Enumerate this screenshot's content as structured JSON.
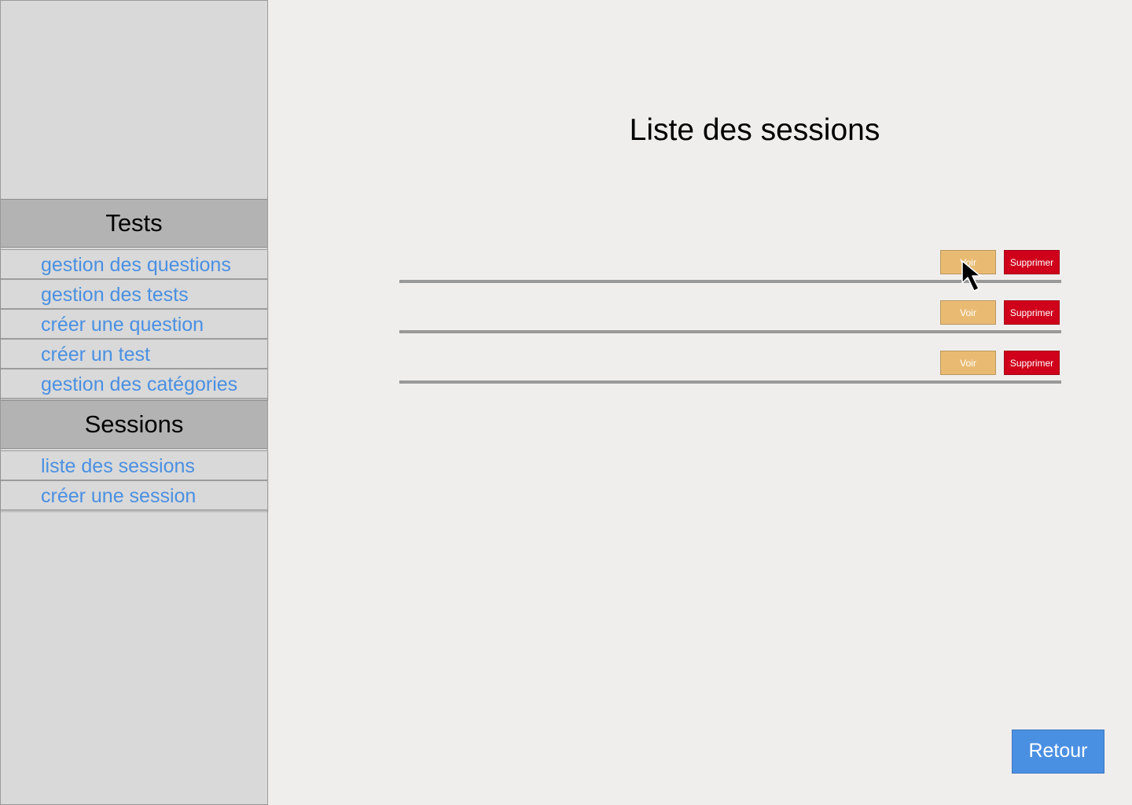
{
  "sidebar": {
    "tests_header": "Tests",
    "tests_items": [
      {
        "label": "gestion des questions"
      },
      {
        "label": "gestion des tests"
      },
      {
        "label": "créer une question"
      },
      {
        "label": "créer un test"
      },
      {
        "label": "gestion des catégories"
      }
    ],
    "sessions_header": "Sessions",
    "sessions_items": [
      {
        "label": "liste des sessions"
      },
      {
        "label": "créer une session"
      }
    ]
  },
  "main": {
    "title": "Liste des sessions",
    "rows": [
      {
        "view_label": "Voir",
        "delete_label": "Supprimer"
      },
      {
        "view_label": "Voir",
        "delete_label": "Supprimer"
      },
      {
        "view_label": "Voir",
        "delete_label": "Supprimer"
      }
    ],
    "back_label": "Retour"
  },
  "colors": {
    "background": "#f0eeed",
    "sidebar": "#d9d9d9",
    "section_header": "#b3b3b3",
    "link": "#4a90e2",
    "view_button": "#e9bb72",
    "delete_button": "#d0021b",
    "back_button": "#4a90e2"
  },
  "icons": {
    "cursor": "mouse-pointer-icon"
  }
}
